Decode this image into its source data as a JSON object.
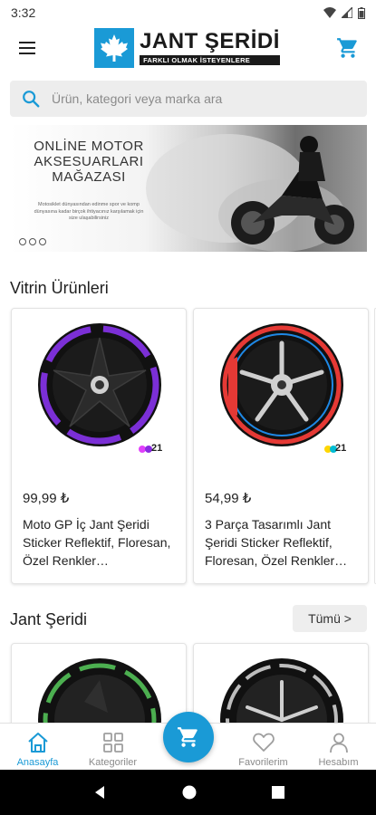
{
  "status_bar": {
    "time": "3:32"
  },
  "header": {
    "brand_name": "JANT ŞERİDİ",
    "brand_tagline": "FARKLI OLMAK İSTEYENLERE",
    "accent_color": "#1a9ad6"
  },
  "search": {
    "placeholder": "Ürün, kategori veya marka ara"
  },
  "banner": {
    "title_line1": "ONLİNE MOTOR",
    "title_line2": "AKSESUARLARI",
    "title_line3": "MAĞAZASI",
    "description": "Motosiklet dünyasından edinme spor ve komp dünyasına kadar birçok ihtiyacınız karşılamak için size ulaşabilirsiniz"
  },
  "sections": {
    "featured": {
      "title": "Vitrin Ürünleri",
      "products": [
        {
          "price": "99,99 ₺",
          "name": "Moto GP İç Jant Şeridi Sticker Reflektif, Floresan, Özel Renkler…",
          "badge": "21",
          "accent": "#8a2be2"
        },
        {
          "price": "54,99 ₺",
          "name": "3 Parça Tasarımlı Jant Şeridi Sticker Reflektif, Floresan, Özel Renkler…",
          "badge": "21",
          "accent": "#e53935"
        }
      ]
    },
    "jant_seridi": {
      "title": "Jant Şeridi",
      "more_label": "Tümü >"
    }
  },
  "bottom_nav": {
    "items": [
      {
        "label": "Anasayfa",
        "icon": "home-icon",
        "active": true
      },
      {
        "label": "Kategoriler",
        "icon": "grid-icon"
      },
      {
        "label": "Favorilerim",
        "icon": "heart-icon"
      },
      {
        "label": "Hesabım",
        "icon": "person-icon"
      }
    ]
  }
}
